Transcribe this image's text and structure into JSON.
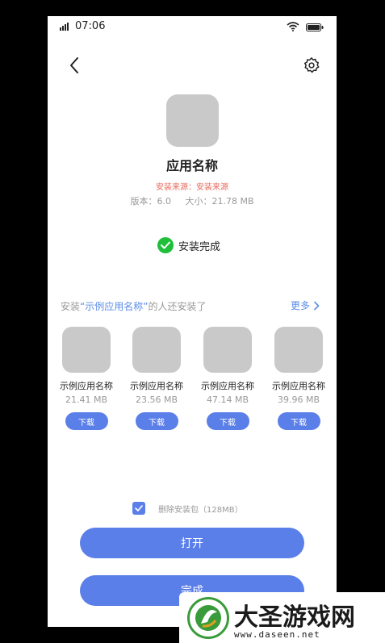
{
  "status_bar": {
    "time": "07:06"
  },
  "app": {
    "name": "应用名称",
    "source": "安装来源：安装来源",
    "version": "版本：6.0",
    "size": "大小：21.78 MB"
  },
  "install_status": "安装完成",
  "recommend": {
    "prefix": "安装",
    "highlight": "“示例应用名称”",
    "suffix": "的人还安装了",
    "more": "更多"
  },
  "apps": [
    {
      "name": "示例应用名称",
      "size": "21.41 MB",
      "button": "下载"
    },
    {
      "name": "示例应用名称",
      "size": "23.56 MB",
      "button": "下载"
    },
    {
      "name": "示例应用名称",
      "size": "47.14 MB",
      "button": "下载"
    },
    {
      "name": "示例应用名称",
      "size": "39.96 MB",
      "button": "下载"
    }
  ],
  "delete_package": {
    "label": "删除安装包（128MB）",
    "checked": true
  },
  "buttons": {
    "open": "打开",
    "done": "完成"
  },
  "watermark": {
    "brand": "大圣游戏网",
    "url": "www.daseen.net"
  },
  "colors": {
    "accent": "#5b7fe8",
    "success": "#1fbf3a",
    "source": "#e86a5c"
  }
}
